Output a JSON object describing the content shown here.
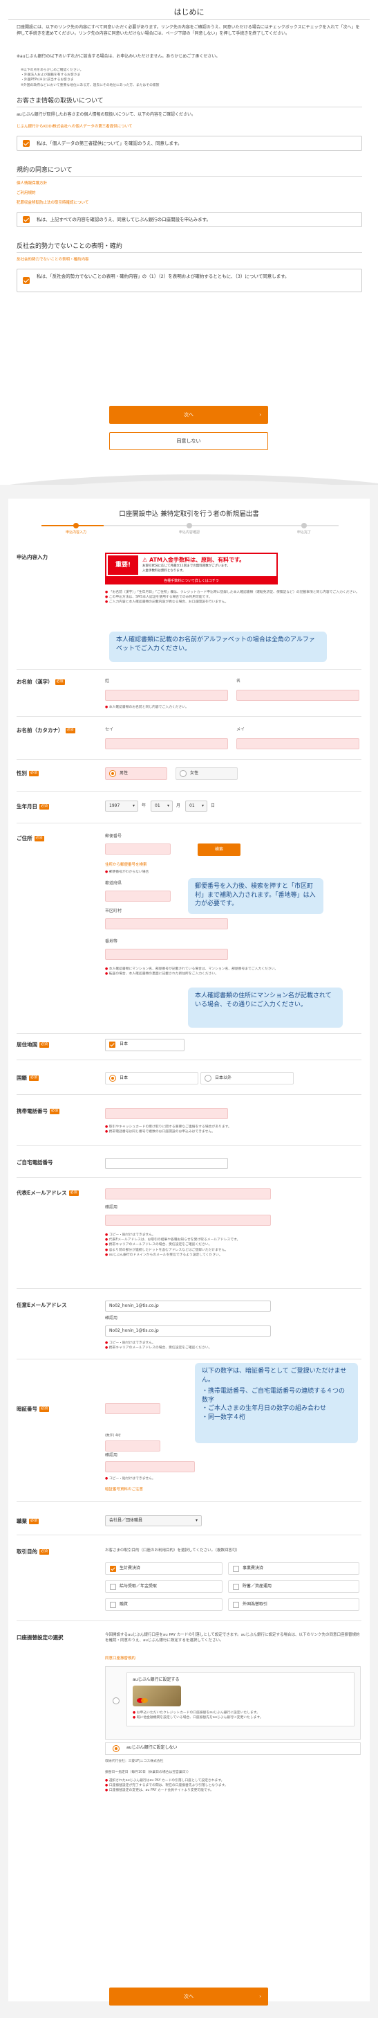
{
  "intro": {
    "title": "はじめに",
    "text": "口座開設には、以下のリンク先の内容にすべて同意いただく必要があります。リンク先の内容をご確認のうえ、同意いただける場合にはチェックボックスにチェックを入れて「次へ」を押して手続きを進めてください。リンク先の内容に同意いただけない場合には、ページ下部の「同意しない」を押して手続きを終了してください。",
    "text2": "※auじぶん銀行の以下のいずれかに該当する場合は、お申込みいただけません。あらかじめご了承ください。",
    "notes": [
      "※以下の点をあらかじめご確認ください。",
      "・外国法人および国籍を有するお客さま",
      "・外国PEPs(※)に該当するお客さま",
      "※外国の政府などにおいて重要な地位にある方、過去にその地位にあった方、またはその家族"
    ]
  },
  "privacy": {
    "title": "お客さま情報の取扱いについて",
    "text": "auじぶん銀行が取得したお客さまの個人情報の取扱いについて、以下の内容をご確認ください。",
    "link": "じぶん銀行からKDDI株式会社への個人データの第三者提供について",
    "checkbox": "私は、「個人データの第三者提供について」を確認のうえ、同意します。"
  },
  "terms": {
    "title": "規約の同意について",
    "links": [
      "個人情報保護方針",
      "ご利用規約",
      "犯罪収益移転防止法の取引時確認について"
    ],
    "checkbox": "私は、上記すべての内容を確認のうえ、同意してじぶん銀行の口座開設を申込みます。"
  },
  "antisocial": {
    "title": "反社会的勢力でないことの表明・確約",
    "link": "反社会的勢力でないことの表明・確約内容",
    "checkbox": "私は、「反社会的勢力でないことの表明・確約内容」の（1）（2）を表明および確約するとともに、（3）について同意します。"
  },
  "buttons": {
    "next": "次へ",
    "disagree": "同意しない",
    "next2": "次へ",
    "arrow": "›"
  },
  "form": {
    "title": "口座開設申込 兼特定取引を行う者の新規届出書",
    "steps": [
      "申込内容入力",
      "申込内容確認",
      "申込完了"
    ],
    "required": "必須",
    "content_label": "申込内容入力",
    "banner_badge": "重要!",
    "banner_title": "ATM入金手数料は、原則、有料です。",
    "banner_sub1": "お取引状況に応じて月最大11回までの無料回数がございます。",
    "banner_sub2": "入金手数料は無料となります。",
    "banner_link": "各種手数料について詳しくはコチラ",
    "content_notes": [
      "「お名前（漢字）」「生年月日」「ご住所」欄は、クレジットカード申込時に登録した本人確認書類（運転免許証、保険証など）の記載事項と同じ内容でご入力ください。",
      "この申込方法は、SMS本人認証を使用する場合でのみ利用可能です。",
      "ご入力内容と本人確認書類の記載内容が異なる場合、お口座開設を行いません。"
    ],
    "tip_name": "本人確認書類に記載のお名前がアルファベットの場合は全角のアルファベットでご入力ください。",
    "name_kanji_label": "お名前（漢字）",
    "sei": "姓",
    "mei": "名",
    "name_note": "本人確認書類のお名前と同じ内容でご入力ください。",
    "name_kana_label": "お名前（カタカナ）",
    "sei_kana": "セイ",
    "mei_kana": "メイ",
    "gender_label": "性別",
    "gender_options": [
      "男性",
      "女性"
    ],
    "birth_label": "生年月日",
    "birth_year": "1997",
    "birth_month": "01",
    "birth_day": "01",
    "birth_units": [
      "年",
      "月",
      "日"
    ],
    "address_label": "ご住所",
    "postal_label": "郵便番号",
    "search_button": "検索",
    "postal_link1": "住所から郵便番号を検索",
    "postal_link2": "郵便番号がわからない場合",
    "pref_label": "都道府県",
    "city_label": "市区町村",
    "street_label": "番地等",
    "tip_postal": "郵便番号を入力後、検索を押すと「市区町村」まで補助入力されます。「番地等」は入力が必要です。",
    "tip_mansion": "本人確認書類の住所にマンション名が記載されている場合、その通りにご入力ください。",
    "address_notes": [
      "本人確認書類にマンション名、部屋番号が記載されている場合は、マンション名、部屋番号までご入力ください。",
      "転居の場合、本人確認書類の裏面に記載された新住所をご入力ください。"
    ],
    "residence_label": "居住地国",
    "residence_value": "日本",
    "nationality_label": "国籍",
    "nationality_options": [
      "日本",
      "日本以外"
    ],
    "mobile_label": "携帯電話番号",
    "mobile_notes": [
      "取引やキャッシュカードの受け取りに関する重要なご連絡をする場合があります。",
      "携帯電話番号は同じ番号で複数のお口座開設のお申込みはできません。"
    ],
    "home_label": "ご自宅電話番号",
    "email_label": "代表Eメールアドレス",
    "confirm_label": "確認用",
    "email_notes": [
      "コピー・貼付けはできません。",
      "代表Eメールアドレスは、お取引の結果や各種お知らせを受け取るメールアドレスです。",
      "携帯キャリアのメールアドレスの場合、受信設定をご確認ください。",
      "@より前の部分が連続したドットを含むアドレスなどはご登録いただけません。",
      "auじぶん銀行のドメインからのメールを受信できるよう設定してください。"
    ],
    "opt_email_label": "任意Eメールアドレス",
    "opt_email_value": "No02_honin_1@tis.co.jp",
    "opt_email_confirm": "No02_honin_1@tis.co.jp",
    "opt_email_notes": [
      "コピー・貼付けはできません。",
      "携帯キャリアのメールアドレスの場合、受信設定をご確認ください。"
    ],
    "pin_label": "暗証番号",
    "pin_tip_title": "以下の数字は、暗証番号として ご登録いただけません。",
    "pin_tip_items": [
      "携帯電話番号、ご自宅電話番号の連続する４つの数字",
      "ご本人さまの生年月日の数字の組み合わせ",
      "同一数字４桁"
    ],
    "pin_sub": "(数字) 4桁",
    "pin_notes": [
      "コピー・貼付けはできません。"
    ],
    "pin_link": "暗証番号資料のご注意",
    "job_label": "職業",
    "job_value": "会社員／団体職員",
    "purpose_label": "取引目的",
    "purpose_hint": "お客さまの取引目的（口座のお利用目的）を選択してください。（複数回答可）",
    "purpose_options": [
      "生計費決済",
      "事業費決済",
      "給与受取／年金受取",
      "貯蓄／資産運用",
      "融資",
      "外国為替取引"
    ],
    "purpose_checked": [
      true,
      false,
      false,
      false,
      false,
      false
    ],
    "linked_label": "口座振替設定の選択",
    "linked_text": "今回開設するauじぶん銀行口座をau PAY カードの引落しとして設定できます。auじぶん銀行に設定する場合は、以下のリンク先の同意口座振替規約を確認・同意のうえ、auじぶん銀行に設定するを選択してください。",
    "linked_link": "同意口座振替規約",
    "linked_opt1": "auじぶん銀行に設定する",
    "linked_opt2": "auじぶん銀行に設定しない",
    "linked_opt1_notes": [
      "お申込いただいたクレジットカードの口座振替をauじぶん銀行に設定いたします。",
      "既に他金融機関を設定している場合、口座振替先をauじぶん銀行に変更いたします。"
    ],
    "linked_company": "収納代行会社：三菱UFJニコス株式会社",
    "linked_date": "振替日＝指定日（毎月10日（休業日の場合は翌営業日））",
    "linked_notes": [
      "選択されたauじぶん銀行はau PAY カードの引落し口座として設定されます。",
      "口座振替設定が完了するまでの間は、現在の口座振替先より引落しとなります。",
      "口座振替設定の変更は、au PAY カード会員サイトより変更可能です。"
    ]
  }
}
